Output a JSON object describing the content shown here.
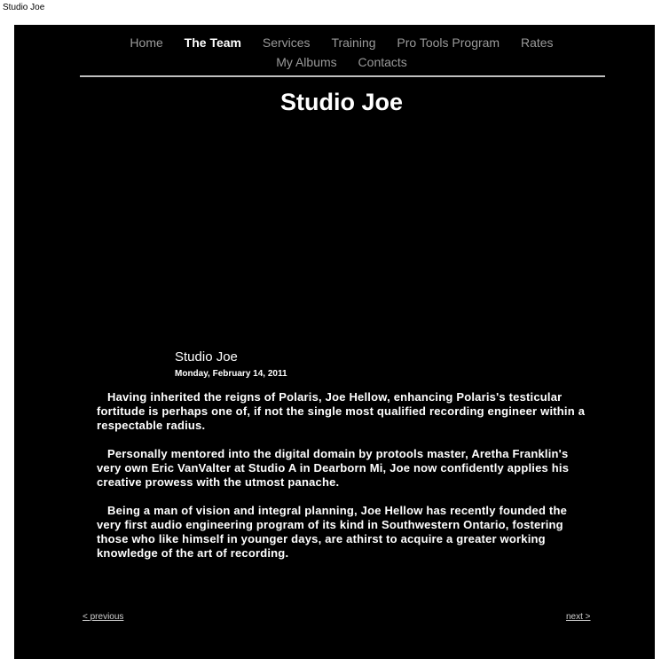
{
  "window": {
    "title": "Studio Joe"
  },
  "nav": {
    "row1": [
      "Home",
      "The Team",
      "Services",
      "Training",
      "Pro Tools Program",
      "Rates"
    ],
    "row2": [
      "My Albums",
      "Contacts"
    ],
    "active": "The Team"
  },
  "site": {
    "title": "Studio Joe"
  },
  "post": {
    "title": "Studio Joe",
    "date": "Monday, February 14, 2011",
    "paragraphs": [
      "Having inherited the reigns of Polaris, Joe Hellow,  enhancing Polaris's testicular fortitude is perhaps one of, if not the single most qualified recording engineer within a respectable radius.",
      "Personally mentored into the digital domain by protools master, Aretha Franklin's very own Eric VanValter at Studio A in Dearborn Mi, Joe now confidently applies his creative prowess with the utmost panache.",
      "Being a man of vision and integral planning, Joe Hellow has recently founded the very first audio engineering program of its kind in Southwestern Ontario, fostering those who like himself in younger days, are athirst to acquire a greater working knowledge of the art of recording."
    ]
  },
  "pager": {
    "prev": "< previous",
    "next": "next >"
  },
  "colors": {
    "background": "#000000",
    "text": "#ffffff",
    "nav_inactive": "#9a9a9a",
    "divider": "#bfbfbf"
  }
}
